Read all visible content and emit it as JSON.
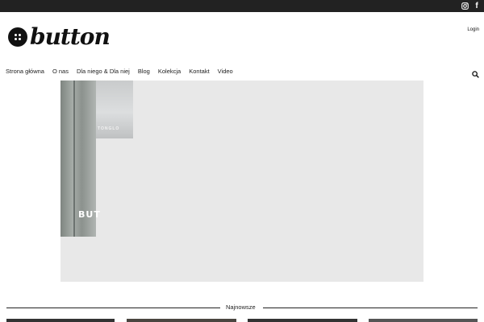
{
  "logo": {
    "text": "button"
  },
  "header": {
    "login_label": "Login"
  },
  "icons": {
    "instagram": "instagram-icon",
    "facebook": "facebook-icon",
    "search": "search-icon"
  },
  "nav": {
    "items": [
      {
        "label": "Strona główna"
      },
      {
        "label": "O nas"
      },
      {
        "label": "Dla niego & Dla niej"
      },
      {
        "label": "Blog"
      },
      {
        "label": "Kolekcja"
      },
      {
        "label": "Kontakt"
      },
      {
        "label": "Video"
      }
    ]
  },
  "hero": {
    "overlay_text": "BUT",
    "panel_tag": "TONGLO"
  },
  "section": {
    "title": "Najnowsze"
  },
  "colors": {
    "topbar": "#222222",
    "hero_bg": "#e8e8e8"
  }
}
